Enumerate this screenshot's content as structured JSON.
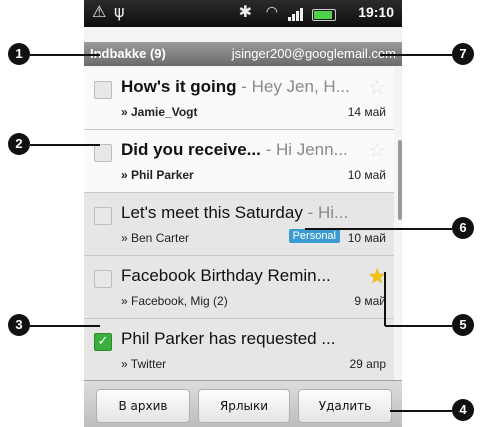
{
  "status_bar": {
    "time": "19:10",
    "icons": [
      "warning-icon",
      "usb-icon",
      "bluetooth-icon",
      "wifi-icon",
      "signal-icon",
      "battery-icon"
    ]
  },
  "account_bar": {
    "folder": "Indbakke (9)",
    "email": "jsinger200@googlemail.com"
  },
  "messages": [
    {
      "subject": "How's it going",
      "snippet": " - Hey Jen, H...",
      "from": "» Jamie_Vogt",
      "date": "14 май",
      "unread": true,
      "starred": false,
      "checked": false,
      "label": ""
    },
    {
      "subject": "Did you receive...",
      "snippet": " - Hi Jenn...",
      "from": "» Phil Parker",
      "date": "10 май",
      "unread": true,
      "starred": false,
      "checked": false,
      "label": ""
    },
    {
      "subject": "Let's meet this Saturday",
      "snippet": " - Hi...",
      "from": "» Ben Carter",
      "date": "10 май",
      "unread": false,
      "starred": false,
      "checked": false,
      "label": "Personal"
    },
    {
      "subject": "Facebook Birthday Remin...",
      "snippet": "",
      "from": "» Facebook, Mig (2)",
      "date": "9 май",
      "unread": false,
      "starred": true,
      "checked": false,
      "label": ""
    },
    {
      "subject": "Phil Parker has requested ...",
      "snippet": "",
      "from": "» Twitter",
      "date": "29 апр",
      "unread": false,
      "starred": false,
      "checked": true,
      "label": ""
    }
  ],
  "actions": {
    "archive": "В архив",
    "labels": "Ярлыки",
    "delete": "Удалить"
  },
  "callouts": [
    "1",
    "2",
    "3",
    "4",
    "5",
    "6",
    "7"
  ],
  "colors": {
    "accent_green": "#3cb03c",
    "label_blue": "#3b9bd1",
    "star_yellow": "#f3c300"
  }
}
